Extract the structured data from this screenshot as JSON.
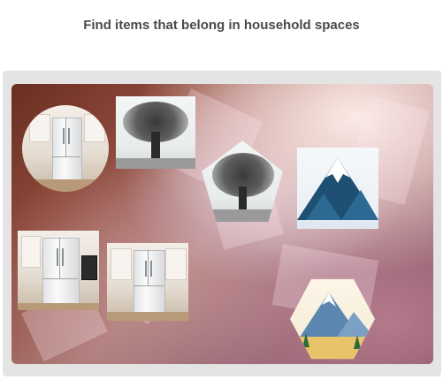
{
  "prompt": {
    "title": "Find items that belong in household spaces"
  },
  "images": [
    {
      "name": "refrigerator-kitchen-circle",
      "depicts": "refrigerator"
    },
    {
      "name": "tree-sketch-square",
      "depicts": "tree"
    },
    {
      "name": "tree-sketch-pentagon",
      "depicts": "tree"
    },
    {
      "name": "snowy-mountain-square",
      "depicts": "mountain"
    },
    {
      "name": "refrigerator-kitchen-square-1",
      "depicts": "refrigerator"
    },
    {
      "name": "refrigerator-kitchen-square-2",
      "depicts": "refrigerator"
    },
    {
      "name": "mountain-painting-hexagon",
      "depicts": "mountain"
    }
  ],
  "colors": {
    "title_text": "#4a4a4a",
    "panel_bg": "#e4e4e4"
  }
}
